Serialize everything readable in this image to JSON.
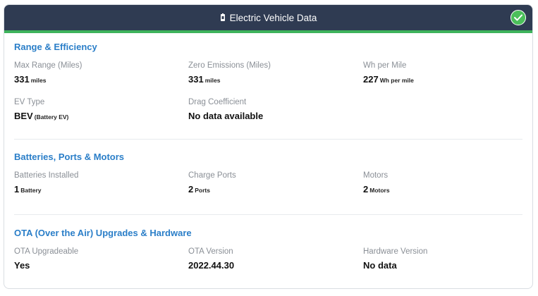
{
  "header": {
    "title": "Electric Vehicle Data",
    "icon": "plug-icon",
    "status_icon": "check-circle-icon",
    "accent_color": "#3eb35c",
    "bar_color": "#2f3b52"
  },
  "sections": [
    {
      "title": "Range & Efficiency",
      "fields": [
        {
          "label": "Max Range (Miles)",
          "value": "331",
          "unit": "miles"
        },
        {
          "label": "Zero Emissions (Miles)",
          "value": "331",
          "unit": "miles"
        },
        {
          "label": "Wh per Mile",
          "value": "227",
          "unit": "Wh per mile"
        },
        {
          "label": "EV Type",
          "value": "BEV",
          "unit": "(Battery EV)"
        },
        {
          "label": "Drag Coefficient",
          "value": "No data available",
          "unit": ""
        }
      ]
    },
    {
      "title": "Batteries, Ports & Motors",
      "fields": [
        {
          "label": "Batteries Installed",
          "value": "1",
          "unit": "Battery"
        },
        {
          "label": "Charge Ports",
          "value": "2",
          "unit": "Ports"
        },
        {
          "label": "Motors",
          "value": "2",
          "unit": "Motors"
        }
      ]
    },
    {
      "title": "OTA (Over the Air) Upgrades & Hardware",
      "fields": [
        {
          "label": "OTA Upgradeable",
          "value": "Yes",
          "unit": ""
        },
        {
          "label": "OTA Version",
          "value": "2022.44.30",
          "unit": ""
        },
        {
          "label": "Hardware Version",
          "value": "No data",
          "unit": ""
        }
      ]
    }
  ]
}
